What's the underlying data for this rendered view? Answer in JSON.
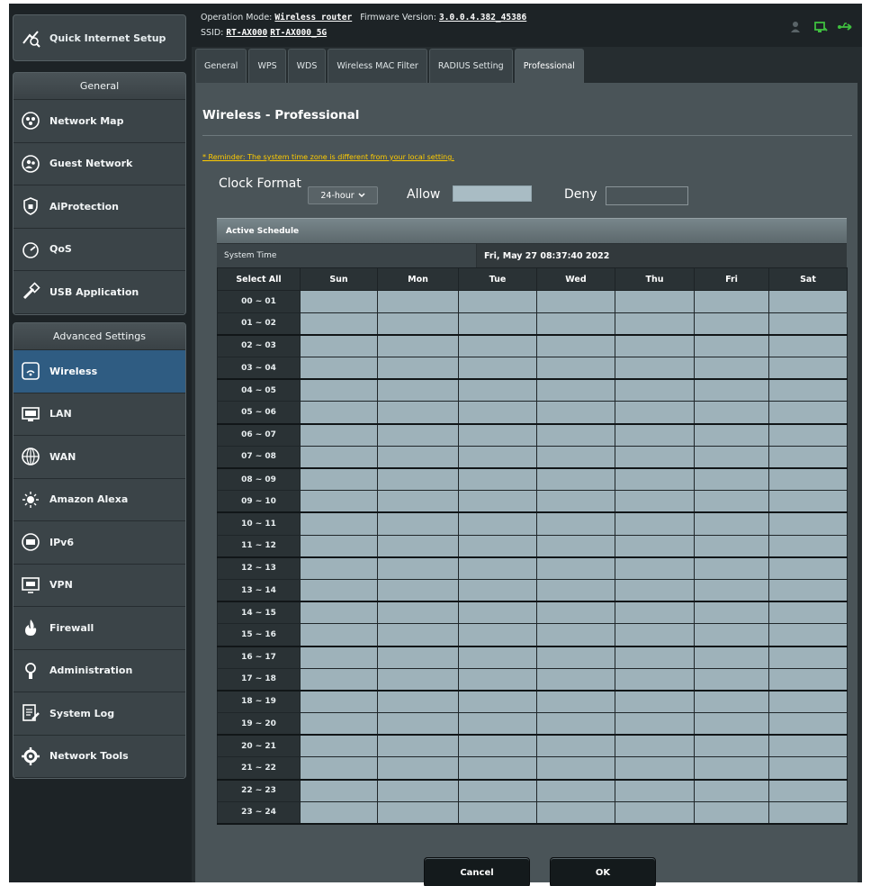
{
  "sidebar": {
    "quick_setup": "Quick Internet Setup",
    "general_header": "General",
    "general_items": [
      {
        "label": "Network Map",
        "icon": "network-map-icon"
      },
      {
        "label": "Guest Network",
        "icon": "guest-network-icon"
      },
      {
        "label": "AiProtection",
        "icon": "aiprotection-icon"
      },
      {
        "label": "QoS",
        "icon": "qos-icon"
      },
      {
        "label": "USB Application",
        "icon": "usb-application-icon"
      }
    ],
    "advanced_header": "Advanced Settings",
    "advanced_items": [
      {
        "label": "Wireless",
        "icon": "wireless-icon",
        "active": true
      },
      {
        "label": "LAN",
        "icon": "lan-icon"
      },
      {
        "label": "WAN",
        "icon": "wan-icon"
      },
      {
        "label": "Amazon Alexa",
        "icon": "alexa-icon"
      },
      {
        "label": "IPv6",
        "icon": "ipv6-icon"
      },
      {
        "label": "VPN",
        "icon": "vpn-icon"
      },
      {
        "label": "Firewall",
        "icon": "firewall-icon"
      },
      {
        "label": "Administration",
        "icon": "administration-icon"
      },
      {
        "label": "System Log",
        "icon": "system-log-icon"
      },
      {
        "label": "Network Tools",
        "icon": "network-tools-icon"
      }
    ]
  },
  "topbar": {
    "op_mode_label": "Operation Mode:",
    "op_mode_value": "Wireless router",
    "firmware_label": "Firmware Version:",
    "firmware_value": "3.0.0.4.382_45386",
    "ssid_label": "SSID:",
    "ssid_1": "RT-AX000",
    "ssid_2": "RT-AX000_5G"
  },
  "tabs": [
    {
      "label": "General"
    },
    {
      "label": "WPS"
    },
    {
      "label": "WDS"
    },
    {
      "label": "Wireless MAC Filter"
    },
    {
      "label": "RADIUS Setting"
    },
    {
      "label": "Professional",
      "active": true
    }
  ],
  "page": {
    "title": "Wireless - Professional",
    "reminder": "* Reminder: The system time zone is different from your local setting.",
    "clock_format_label": "Clock Format",
    "clock_format_value": "24-hour",
    "allow_label": "Allow",
    "deny_label": "Deny"
  },
  "schedule": {
    "header": "Active Schedule",
    "system_time_label": "System Time",
    "system_time_value": "Fri, May 27 08:37:40 2022",
    "select_all": "Select All",
    "days": [
      "Sun",
      "Mon",
      "Tue",
      "Wed",
      "Thu",
      "Fri",
      "Sat"
    ],
    "hours": [
      "00 ~ 01",
      "01 ~ 02",
      "02 ~ 03",
      "03 ~ 04",
      "04 ~ 05",
      "05 ~ 06",
      "06 ~ 07",
      "07 ~ 08",
      "08 ~ 09",
      "09 ~ 10",
      "10 ~ 11",
      "11 ~ 12",
      "12 ~ 13",
      "13 ~ 14",
      "14 ~ 15",
      "15 ~ 16",
      "16 ~ 17",
      "17 ~ 18",
      "18 ~ 19",
      "19 ~ 20",
      "20 ~ 21",
      "21 ~ 22",
      "22 ~ 23",
      "23 ~ 24"
    ]
  },
  "buttons": {
    "cancel": "Cancel",
    "ok": "OK"
  },
  "colors": {
    "allow_cell": "#9eb2ba",
    "active_nav": "#2f5c82",
    "reminder": "#ffcc00"
  }
}
